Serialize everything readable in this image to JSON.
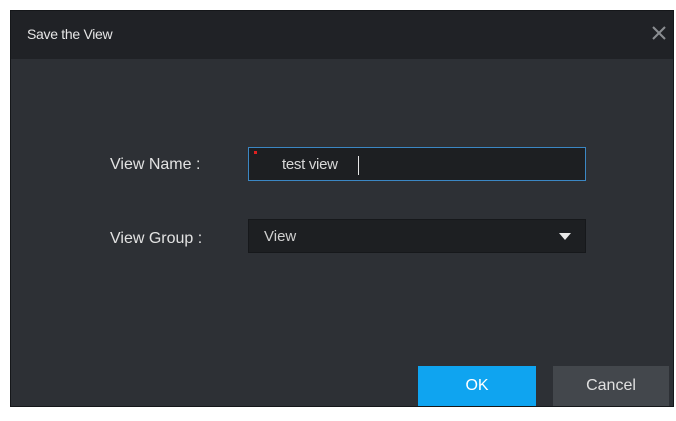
{
  "dialog": {
    "title": "Save the View",
    "close_icon": "close-icon"
  },
  "form": {
    "view_name_label": "View Name :",
    "view_name_value": "test view",
    "view_group_label": "View Group :",
    "view_group_value": "View"
  },
  "buttons": {
    "ok_label": "OK",
    "cancel_label": "Cancel"
  },
  "colors": {
    "dialog_bg": "#2d3035",
    "titlebar_bg": "#202226",
    "input_bg": "#1d1f22",
    "input_focus_border": "#3b87c4",
    "primary_button": "#0fa4f0",
    "secondary_button": "#43474c",
    "required_mark": "#e02020"
  }
}
